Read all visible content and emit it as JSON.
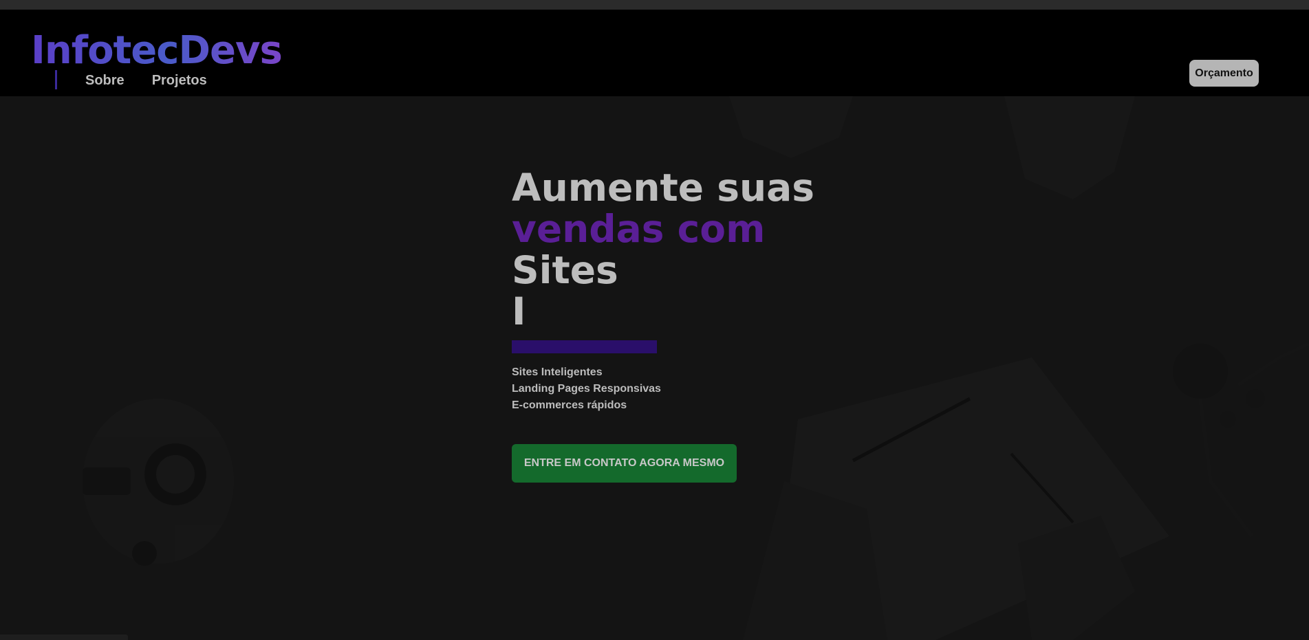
{
  "header": {
    "logo": "InfotecDevs",
    "nav": [
      {
        "label": "Sobre"
      },
      {
        "label": "Projetos"
      }
    ],
    "budget_button": "Orçamento"
  },
  "hero": {
    "headline": {
      "line1": "Aumente suas",
      "line2": "vendas com",
      "line3": "Sites",
      "cursor": "I"
    },
    "features": [
      "Sites Inteligentes",
      "Landing Pages Responsivas",
      "E-commerces rápidos"
    ],
    "cta": "ENTRE EM CONTATO AGORA MESMO"
  },
  "colors": {
    "background": "#141414",
    "navbar": "#000000",
    "accent_purple": "#5a1f96",
    "accent_bar": "#2a0f6a",
    "cta_green": "#146a2c",
    "text": "#bdbdbd"
  }
}
